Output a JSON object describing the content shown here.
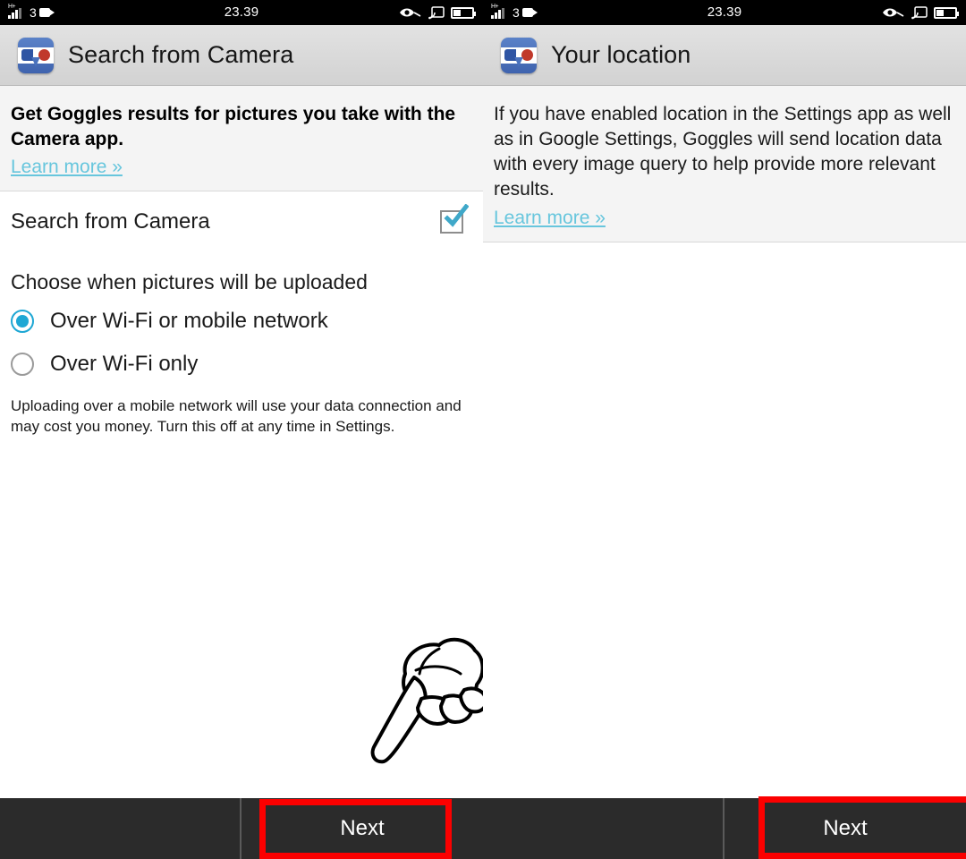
{
  "status_bar": {
    "network_type": "H+",
    "sim_label": "3",
    "clock": "23.39",
    "icons": [
      "signal-bars-icon",
      "video-camera-icon",
      "eye-icon",
      "cast-icon",
      "battery-icon"
    ]
  },
  "left_panel": {
    "title": "Search from Camera",
    "app_icon": "google-goggles-icon",
    "info": {
      "heading": "Get Goggles results for pictures you take with the Camera app.",
      "link": "Learn more »"
    },
    "toggle_row": {
      "label": "Search from Camera",
      "checked": true
    },
    "section_title": "Choose when pictures will be uploaded",
    "options": [
      {
        "label": "Over Wi-Fi or mobile network",
        "selected": true
      },
      {
        "label": "Over Wi-Fi only",
        "selected": false
      }
    ],
    "footnote": "Uploading over a mobile network will use your data connection and may cost you money. Turn this off at any time in Settings.",
    "next_button": "Next"
  },
  "right_panel": {
    "title": "Your location",
    "app_icon": "google-goggles-icon",
    "info": {
      "body": "If you have enabled location in the Settings app as well as in Google Settings, Goggles will send location data with every image query to help provide more relevant results.",
      "link": "Learn more »"
    },
    "next_button": "Next"
  },
  "annotations": {
    "highlight_color": "#fb0000",
    "pointer_icon": "pointing-hand-icon"
  },
  "colors": {
    "accent": "#1ea7d4",
    "link": "#67c6dd",
    "titlebar": "#d9d9d9",
    "bottombar": "#2b2b2b",
    "info_bg": "#f4f4f4"
  }
}
